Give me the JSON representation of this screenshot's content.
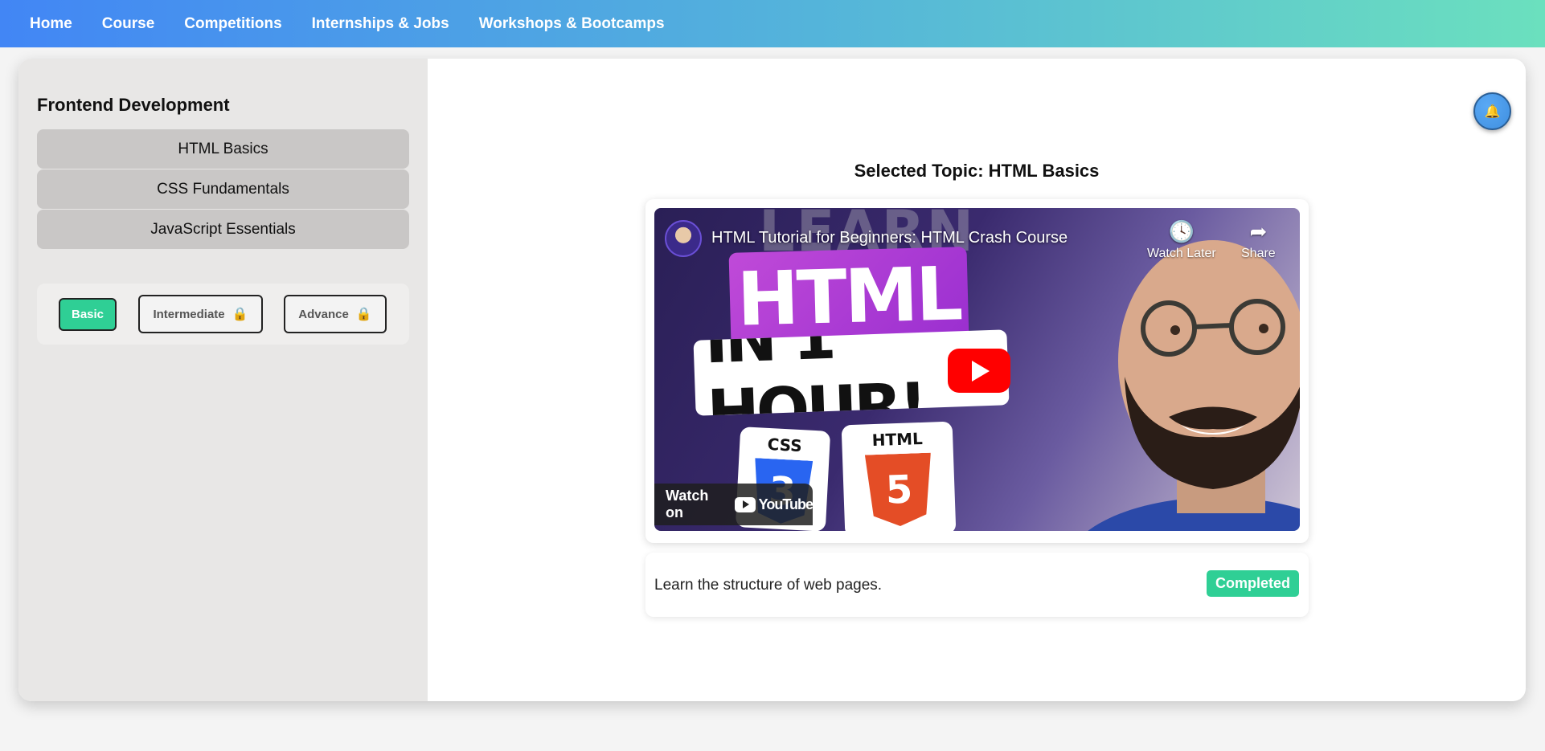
{
  "nav": {
    "items": [
      "Home",
      "Course",
      "Competitions",
      "Internships & Jobs",
      "Workshops & Bootcamps"
    ]
  },
  "sidebar": {
    "title": "Frontend Development",
    "topics": [
      "HTML Basics",
      "CSS Fundamentals",
      "JavaScript Essentials"
    ],
    "levels": [
      {
        "label": "Basic",
        "locked": false,
        "active": true
      },
      {
        "label": "Intermediate",
        "locked": true,
        "active": false
      },
      {
        "label": "Advance",
        "locked": true,
        "active": false
      }
    ]
  },
  "header": {
    "notification_icon": "bell-icon"
  },
  "main": {
    "selected_topic": "Selected Topic: HTML Basics",
    "video": {
      "title": "HTML Tutorial for Beginners: HTML Crash Course",
      "thumbnail_text_bg": "LEARN",
      "thumbnail_text_main": "HTML",
      "thumbnail_text_sub": "IN 1 HOUR!",
      "logo_css_label": "CSS",
      "logo_css_number": "3",
      "logo_html_label": "HTML",
      "logo_html_number": "5",
      "watch_later": "Watch Later",
      "share": "Share",
      "watch_on": "Watch on",
      "youtube": "YouTube"
    },
    "description": "Learn the structure of web pages.",
    "status": "Completed"
  },
  "colors": {
    "accent_green": "#2fcf95",
    "nav_gradient_start": "#4286f5",
    "nav_gradient_end": "#6be0be",
    "youtube_red": "#ff0000",
    "css_blue": "#2965f1",
    "html_orange": "#e44d26"
  }
}
